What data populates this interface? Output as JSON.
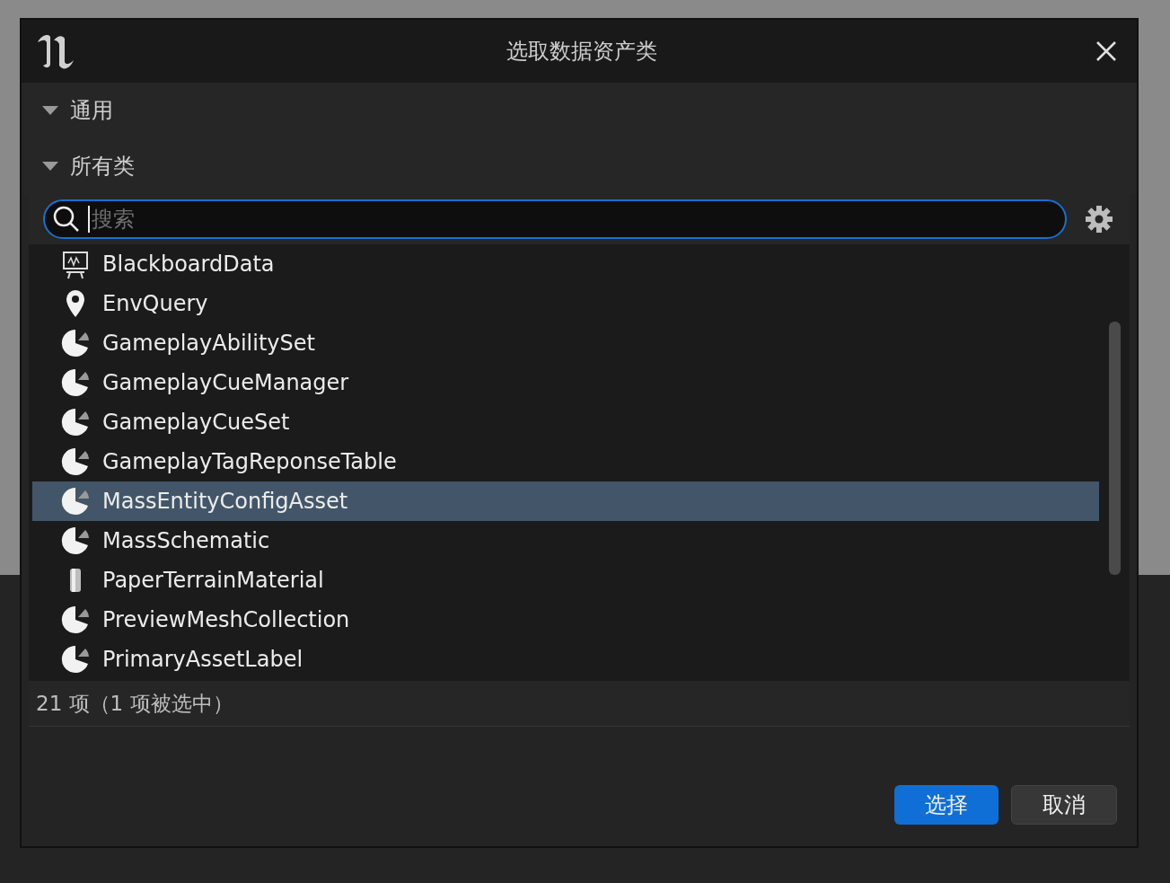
{
  "window": {
    "title": "选取数据资产类"
  },
  "sections": [
    {
      "label": "通用",
      "expanded": true
    },
    {
      "label": "所有类",
      "expanded": true
    }
  ],
  "search": {
    "placeholder": "搜索"
  },
  "items": [
    {
      "label": "BlackboardData",
      "kind": "blackboard",
      "selected": false
    },
    {
      "label": "EnvQuery",
      "kind": "query",
      "selected": false
    },
    {
      "label": "GameplayAbilitySet",
      "kind": "asset",
      "selected": false
    },
    {
      "label": "GameplayCueManager",
      "kind": "asset",
      "selected": false
    },
    {
      "label": "GameplayCueSet",
      "kind": "asset",
      "selected": false
    },
    {
      "label": "GameplayTagReponseTable",
      "kind": "asset",
      "selected": false
    },
    {
      "label": "MassEntityConfigAsset",
      "kind": "asset",
      "selected": true
    },
    {
      "label": "MassSchematic",
      "kind": "asset",
      "selected": false
    },
    {
      "label": "PaperTerrainMaterial",
      "kind": "material",
      "selected": false
    },
    {
      "label": "PreviewMeshCollection",
      "kind": "asset",
      "selected": false
    },
    {
      "label": "PrimaryAssetLabel",
      "kind": "asset",
      "selected": false
    }
  ],
  "status": "21 项（1 项被选中）",
  "buttons": [
    {
      "label": "选择",
      "kind": "primary"
    },
    {
      "label": "取消",
      "kind": "secondary"
    }
  ]
}
